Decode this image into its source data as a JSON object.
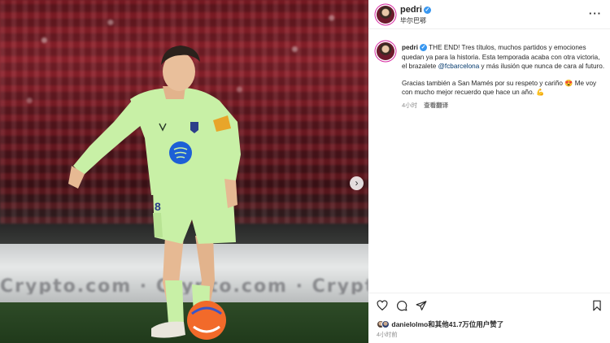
{
  "photo": {
    "ad_text": "Crypto.com  ·  Crypto.com  ·  Crypto.com",
    "jersey_number": "8",
    "colors": {
      "kit": "#c8f0a6",
      "armband": "#e8a52a",
      "sponsor_badge": "#1d5fd6",
      "ball": "#f26a2a"
    }
  },
  "post": {
    "header": {
      "username": "pedri",
      "location": "毕尔巴鄂"
    },
    "caption": {
      "username": "pedri",
      "text_1": "THE END! Tres títulos, muchos partidos y emociones quedan ya para la historia. Esta temporada acaba con otra victoria, el brazalete",
      "mention": "@fcbarcelona",
      "text_2": "y más ilusión que nunca de cara al futuro.",
      "paragraph_2": "Gracias también a San Mamés por su respeto y cariño 😍 Me voy con mucho mejor recuerdo que hace un año. 💪",
      "time": "4小时",
      "see_translation": "查看翻译"
    },
    "likes": {
      "first_user": "danielolmo",
      "rest": "和其他41.7万位用户赞了"
    },
    "time": "4小时前",
    "icons": [
      "heart-icon",
      "comment-icon",
      "share-icon",
      "bookmark-icon",
      "more-icon",
      "verified-icon",
      "chevron-right-icon"
    ],
    "colors": {
      "verified": "#3897f0",
      "mention": "#00376b",
      "meta": "#8e8e8e"
    }
  }
}
